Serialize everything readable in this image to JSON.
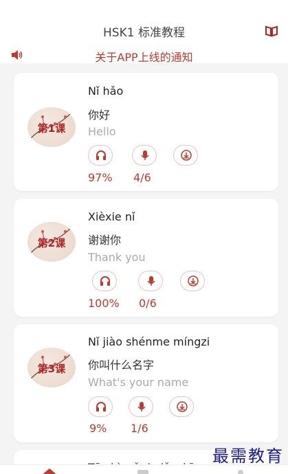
{
  "header": {
    "title": "HSK1 标准教程",
    "book_icon": "book-icon"
  },
  "notice": {
    "text": "关于APP上线的通知",
    "icon": "speaker-icon"
  },
  "lessons": [
    {
      "badge": "第1课",
      "pinyin": "Nǐ hǎo",
      "hanzi": "你好",
      "english": "Hello",
      "progress": "97%",
      "recorded": "4/6"
    },
    {
      "badge": "第2课",
      "pinyin": "Xièxie nǐ",
      "hanzi": "谢谢你",
      "english": "Thank you",
      "progress": "100%",
      "recorded": "0/6"
    },
    {
      "badge": "第3课",
      "pinyin": "Nǐ jiào shénme míngzi",
      "hanzi": "你叫什么名字",
      "english": "What's your name",
      "progress": "9%",
      "recorded": "1/6"
    },
    {
      "pinyin": "Tā shì wǒ de lǎoshī"
    }
  ],
  "watermark": "最需教育",
  "colors": {
    "accent": "#c0392b",
    "badge_text": "#b22222",
    "watermark": "#1a1aa6"
  }
}
